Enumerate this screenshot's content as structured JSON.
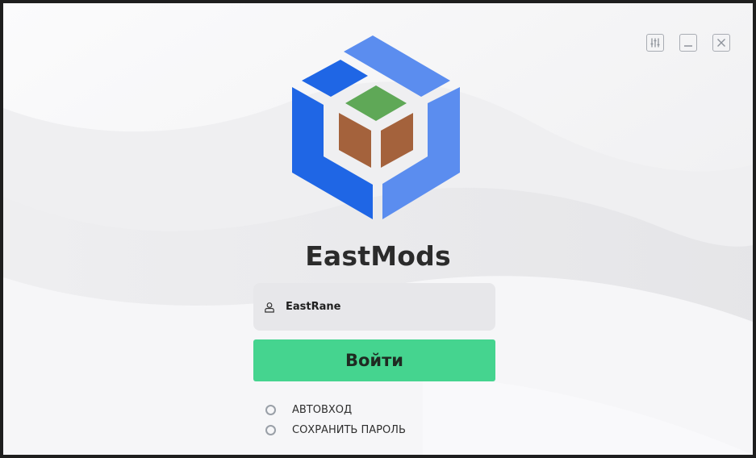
{
  "app": {
    "title": "EastMods"
  },
  "window_controls": {
    "settings_icon": "sliders-icon",
    "minimize_icon": "minimize-icon",
    "close_icon": "close-icon"
  },
  "login": {
    "username_value": "EastRane",
    "user_icon": "user-icon",
    "submit_label": "Войти"
  },
  "options": {
    "autologin_label": "АВТОВХОД",
    "save_password_label": "СОХРАНИТЬ ПАРОЛЬ"
  },
  "colors": {
    "accent_green": "#45d48f",
    "logo_dark_blue": "#1f66e5",
    "logo_light_blue": "#5b8def",
    "logo_green": "#5fa857",
    "logo_brown": "#a4623c"
  }
}
